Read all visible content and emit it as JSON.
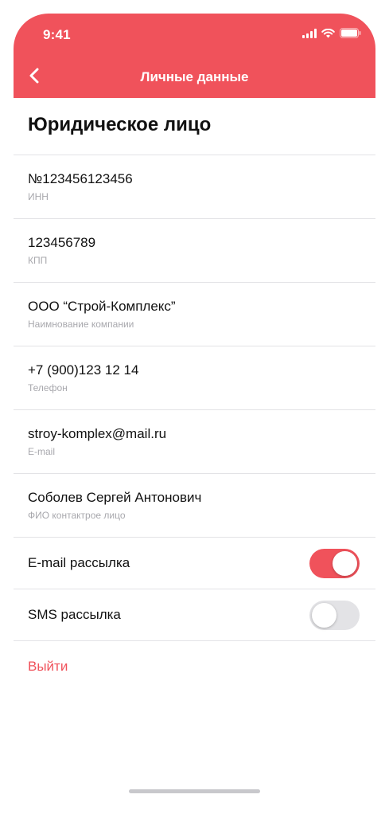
{
  "status_bar": {
    "time": "9:41"
  },
  "header": {
    "title": "Личные данные",
    "back_icon": "chevron-left-icon",
    "background_color": "#f0525b"
  },
  "section": {
    "title": "Юридическое лицо"
  },
  "fields": [
    {
      "value": "№123456123456",
      "label": "ИНН"
    },
    {
      "value": "123456789",
      "label": "КПП"
    },
    {
      "value": "ООО “Строй-Комплекс”",
      "label": "Наимнование компании"
    },
    {
      "value": "+7 (900)123 12 14",
      "label": "Телефон"
    },
    {
      "value": "stroy-komplex@mail.ru",
      "label": "E-mail"
    },
    {
      "value": "Соболев Сергей Антонович",
      "label": "ФИО контактрое лицо"
    }
  ],
  "toggles": [
    {
      "label": "E-mail рассылка",
      "on": true
    },
    {
      "label": "SMS рассылка",
      "on": false
    }
  ],
  "logout_label": "Выйти",
  "colors": {
    "accent": "#f0525b",
    "divider": "#e3e3e6",
    "secondary_text": "#a8a8ad"
  }
}
